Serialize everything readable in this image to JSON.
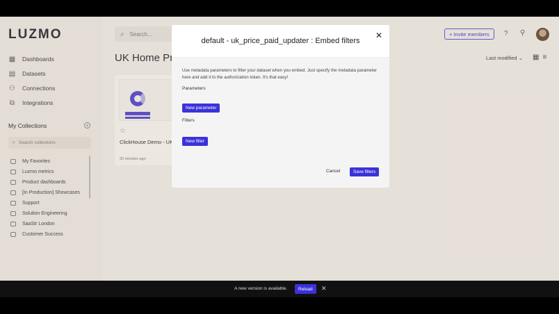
{
  "app": {
    "logo": "LUZMO"
  },
  "sidebar": {
    "nav": [
      {
        "label": "Dashboards",
        "icon": "dashboard-icon"
      },
      {
        "label": "Datasets",
        "icon": "dataset-icon"
      },
      {
        "label": "Connections",
        "icon": "connections-icon"
      },
      {
        "label": "Integrations",
        "icon": "integrations-icon"
      }
    ],
    "collections_title": "My Collections",
    "collections_search_placeholder": "Search collections",
    "collections": [
      "My Favorites",
      "Luzmo metrics",
      "Product dashboards",
      "[In Production] Showcases",
      "Support",
      "Solution Engineering",
      "SaaStr London",
      "Customer Success"
    ]
  },
  "header": {
    "search_placeholder": "Search...",
    "invite_label": "+ Invite members",
    "help_icon": "help-icon"
  },
  "main": {
    "title": "UK Home Prices",
    "sort_label": "Last modified",
    "card": {
      "title": "ClickHouse Demo - UK",
      "time": "20 minutes ago"
    }
  },
  "modal": {
    "title": "default - uk_price_paid_updater : Embed filters",
    "description": "Use metadata parameters to filter your dataset when you embed. Just specify the metadata parameter here and add it to the authorization token. It's that easy!",
    "parameters_label": "Parameters",
    "new_parameter_label": "New parameter",
    "filters_label": "Filters",
    "new_filter_label": "New filter",
    "cancel_label": "Cancel",
    "save_label": "Save filters"
  },
  "toast": {
    "message": "A new version is available.",
    "reload_label": "Reload"
  },
  "colors": {
    "accent": "#3b32d8",
    "background": "#f4f3f1"
  }
}
